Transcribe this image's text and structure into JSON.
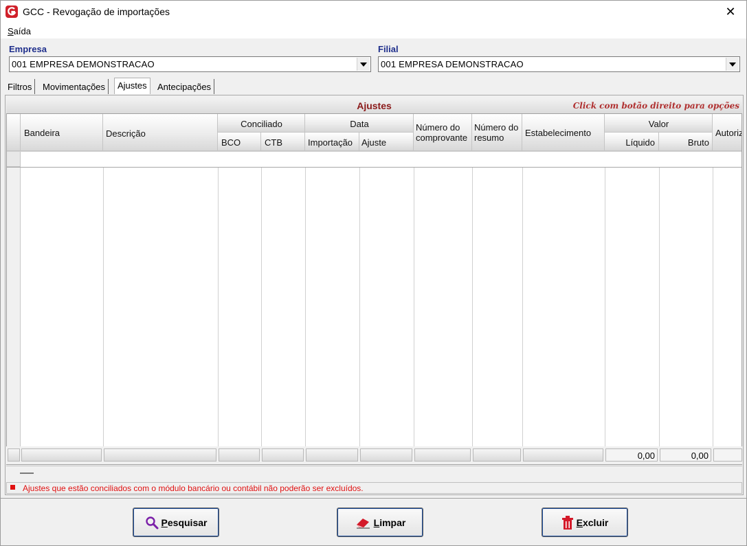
{
  "window": {
    "title": "GCC - Revogação de importações",
    "close_glyph": "✕"
  },
  "menu": {
    "items": [
      {
        "label_underlined": "S",
        "label_rest": "aída"
      }
    ]
  },
  "empresa": {
    "label": "Empresa",
    "value": "001 EMPRESA DEMONSTRACAO"
  },
  "filial": {
    "label": "Filial",
    "value": "001 EMPRESA DEMONSTRACAO"
  },
  "tabs": [
    {
      "label": "Filtros",
      "active": false
    },
    {
      "label": "Movimentações",
      "active": false
    },
    {
      "label": "Ajustes",
      "active": true
    },
    {
      "label": "Antecipações",
      "active": false
    }
  ],
  "grid": {
    "title": "Ajustes",
    "hint": "Click com botão direito para opções",
    "headers": {
      "bandeira": "Bandeira",
      "descricao": "Descrição",
      "conciliado": "Conciliado",
      "bco": "BCO",
      "ctb": "CTB",
      "data": "Data",
      "importacao": "Importação",
      "ajuste": "Ajuste",
      "num_comprovante_1": "Número do",
      "num_comprovante_2": "comprovante",
      "num_resumo_1": "Número do",
      "num_resumo_2": "resumo",
      "estabelecimento": "Estabelecimento",
      "valor": "Valor",
      "liquido": "Líquido",
      "bruto": "Bruto",
      "autoriz": "Autoriz"
    },
    "totals": {
      "liquido": "0,00",
      "bruto": "0,00"
    }
  },
  "note": "Ajustes que estão conciliados com o módulo bancário ou contábil não poderão ser excluídos.",
  "buttons": {
    "pesquisar": {
      "u": "P",
      "rest": "esquisar",
      "icon": "search-icon"
    },
    "limpar": {
      "u": "L",
      "rest": "impar",
      "icon": "eraser-icon"
    },
    "excluir": {
      "u": "E",
      "rest": "xcluir",
      "icon": "trash-icon"
    }
  },
  "colors": {
    "label_blue": "#1f2f8c",
    "grid_title": "#8b1a1a",
    "hint": "#b03030",
    "warning_red": "#e01010",
    "button_focus": "#1d4e9e"
  }
}
